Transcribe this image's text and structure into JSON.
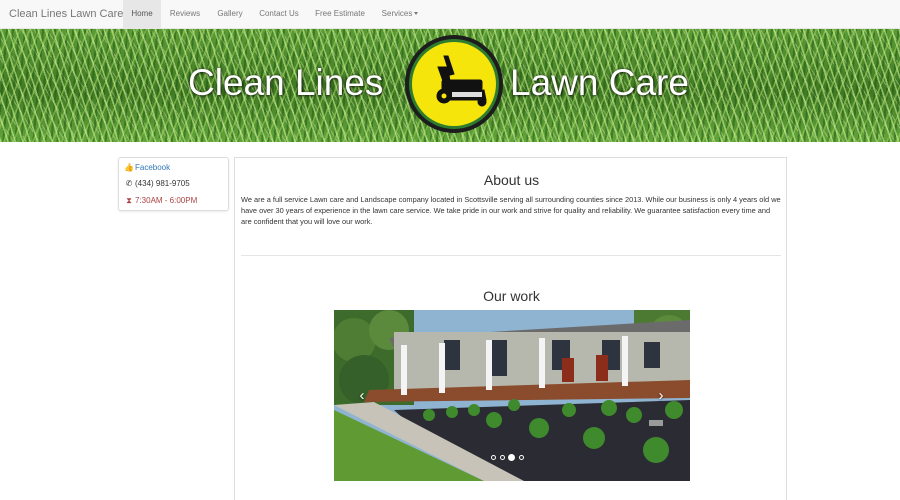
{
  "navbar": {
    "brand": "Clean Lines Lawn Care",
    "items": [
      {
        "label": "Home",
        "active": true
      },
      {
        "label": "Reviews"
      },
      {
        "label": "Gallery"
      },
      {
        "label": "Contact Us"
      },
      {
        "label": "Free Estimate"
      },
      {
        "label": "Services"
      }
    ]
  },
  "hero": {
    "title_left": "Clean Lines",
    "title_right": "Lawn Care",
    "logo_icon": "lawn-mower-logo",
    "colors": {
      "logo_yellow": "#f5e50b",
      "logo_ring": "#111111",
      "grass": "#4c8a2a"
    }
  },
  "sidebar": {
    "facebook": {
      "icon": "thumbs-up-icon",
      "label": "Facebook"
    },
    "phone": {
      "icon": "phone-icon",
      "label": "(434) 981-9705"
    },
    "hours": {
      "icon": "hourglass-icon",
      "label": "7:30AM - 6:00PM"
    }
  },
  "about": {
    "title": "About us",
    "text": "We are a full service Lawn care and Landscape company located in Scottsville serving all surrounding counties since 2013. While our business is only 4 years old we have over 30 years of experience in the lawn care service. We take pride in our work and strive for quality and reliability. We guarantee satisfaction every time and are confident that you will love our work."
  },
  "work": {
    "title": "Our work",
    "carousel": {
      "prev_icon": "chevron-left-icon",
      "next_icon": "chevron-right-icon",
      "slide_count": 4,
      "active_slide": 3
    }
  },
  "colors": {
    "link": "#337ab7",
    "hours": "#a94442",
    "navbar_bg": "#f8f8f8"
  }
}
